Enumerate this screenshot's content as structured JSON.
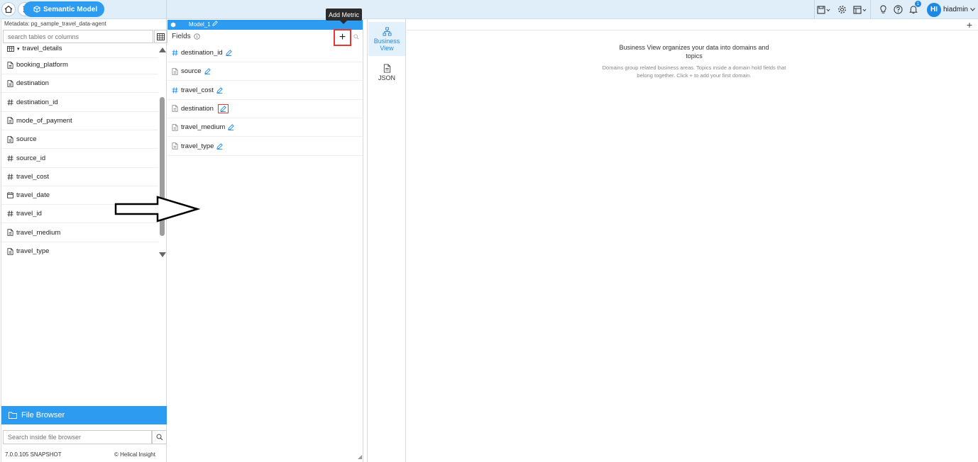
{
  "header": {
    "breadcrumb_label": "Semantic Model",
    "user_initials": "HI",
    "user_name": "hiadmin",
    "notification_count": "1"
  },
  "left": {
    "metadata_label": "Metadata: pg_sample_travel_data-agent",
    "search_placeholder": "search tables or columns",
    "table_name": "travel_details",
    "columns": [
      {
        "name": "booking_platform",
        "type": "text"
      },
      {
        "name": "destination",
        "type": "text"
      },
      {
        "name": "destination_id",
        "type": "number"
      },
      {
        "name": "mode_of_payment",
        "type": "text"
      },
      {
        "name": "source",
        "type": "text"
      },
      {
        "name": "source_id",
        "type": "number"
      },
      {
        "name": "travel_cost",
        "type": "number"
      },
      {
        "name": "travel_date",
        "type": "date"
      },
      {
        "name": "travel_id",
        "type": "number"
      },
      {
        "name": "travel_medium",
        "type": "text"
      },
      {
        "name": "travel_type",
        "type": "text"
      }
    ],
    "file_browser_label": "File Browser",
    "file_search_placeholder": "Search inside file browser",
    "version": "7.0.0.105 SNAPSHOT",
    "brand": "Helical Insight"
  },
  "middle": {
    "model_name": "Model_1",
    "fields_label": "Fields",
    "add_metric_tooltip": "Add Metric",
    "fields": [
      {
        "name": "destination_id",
        "type": "number"
      },
      {
        "name": "source",
        "type": "text"
      },
      {
        "name": "travel_cost",
        "type": "number"
      },
      {
        "name": "destination",
        "type": "text"
      },
      {
        "name": "travel_medium",
        "type": "text"
      },
      {
        "name": "travel_type",
        "type": "text"
      }
    ]
  },
  "views": {
    "business_view_label_1": "Business",
    "business_view_label_2": "View",
    "json_label": "JSON"
  },
  "right": {
    "title": "Business View organizes your data into domains and topics",
    "description": "Domains group related business areas. Topics inside a domain hold fields that belong together. Click + to add your first domain."
  },
  "colors": {
    "accent": "#2d9cf0",
    "highlight": "#e53935",
    "topbar": "#dfeef9"
  }
}
